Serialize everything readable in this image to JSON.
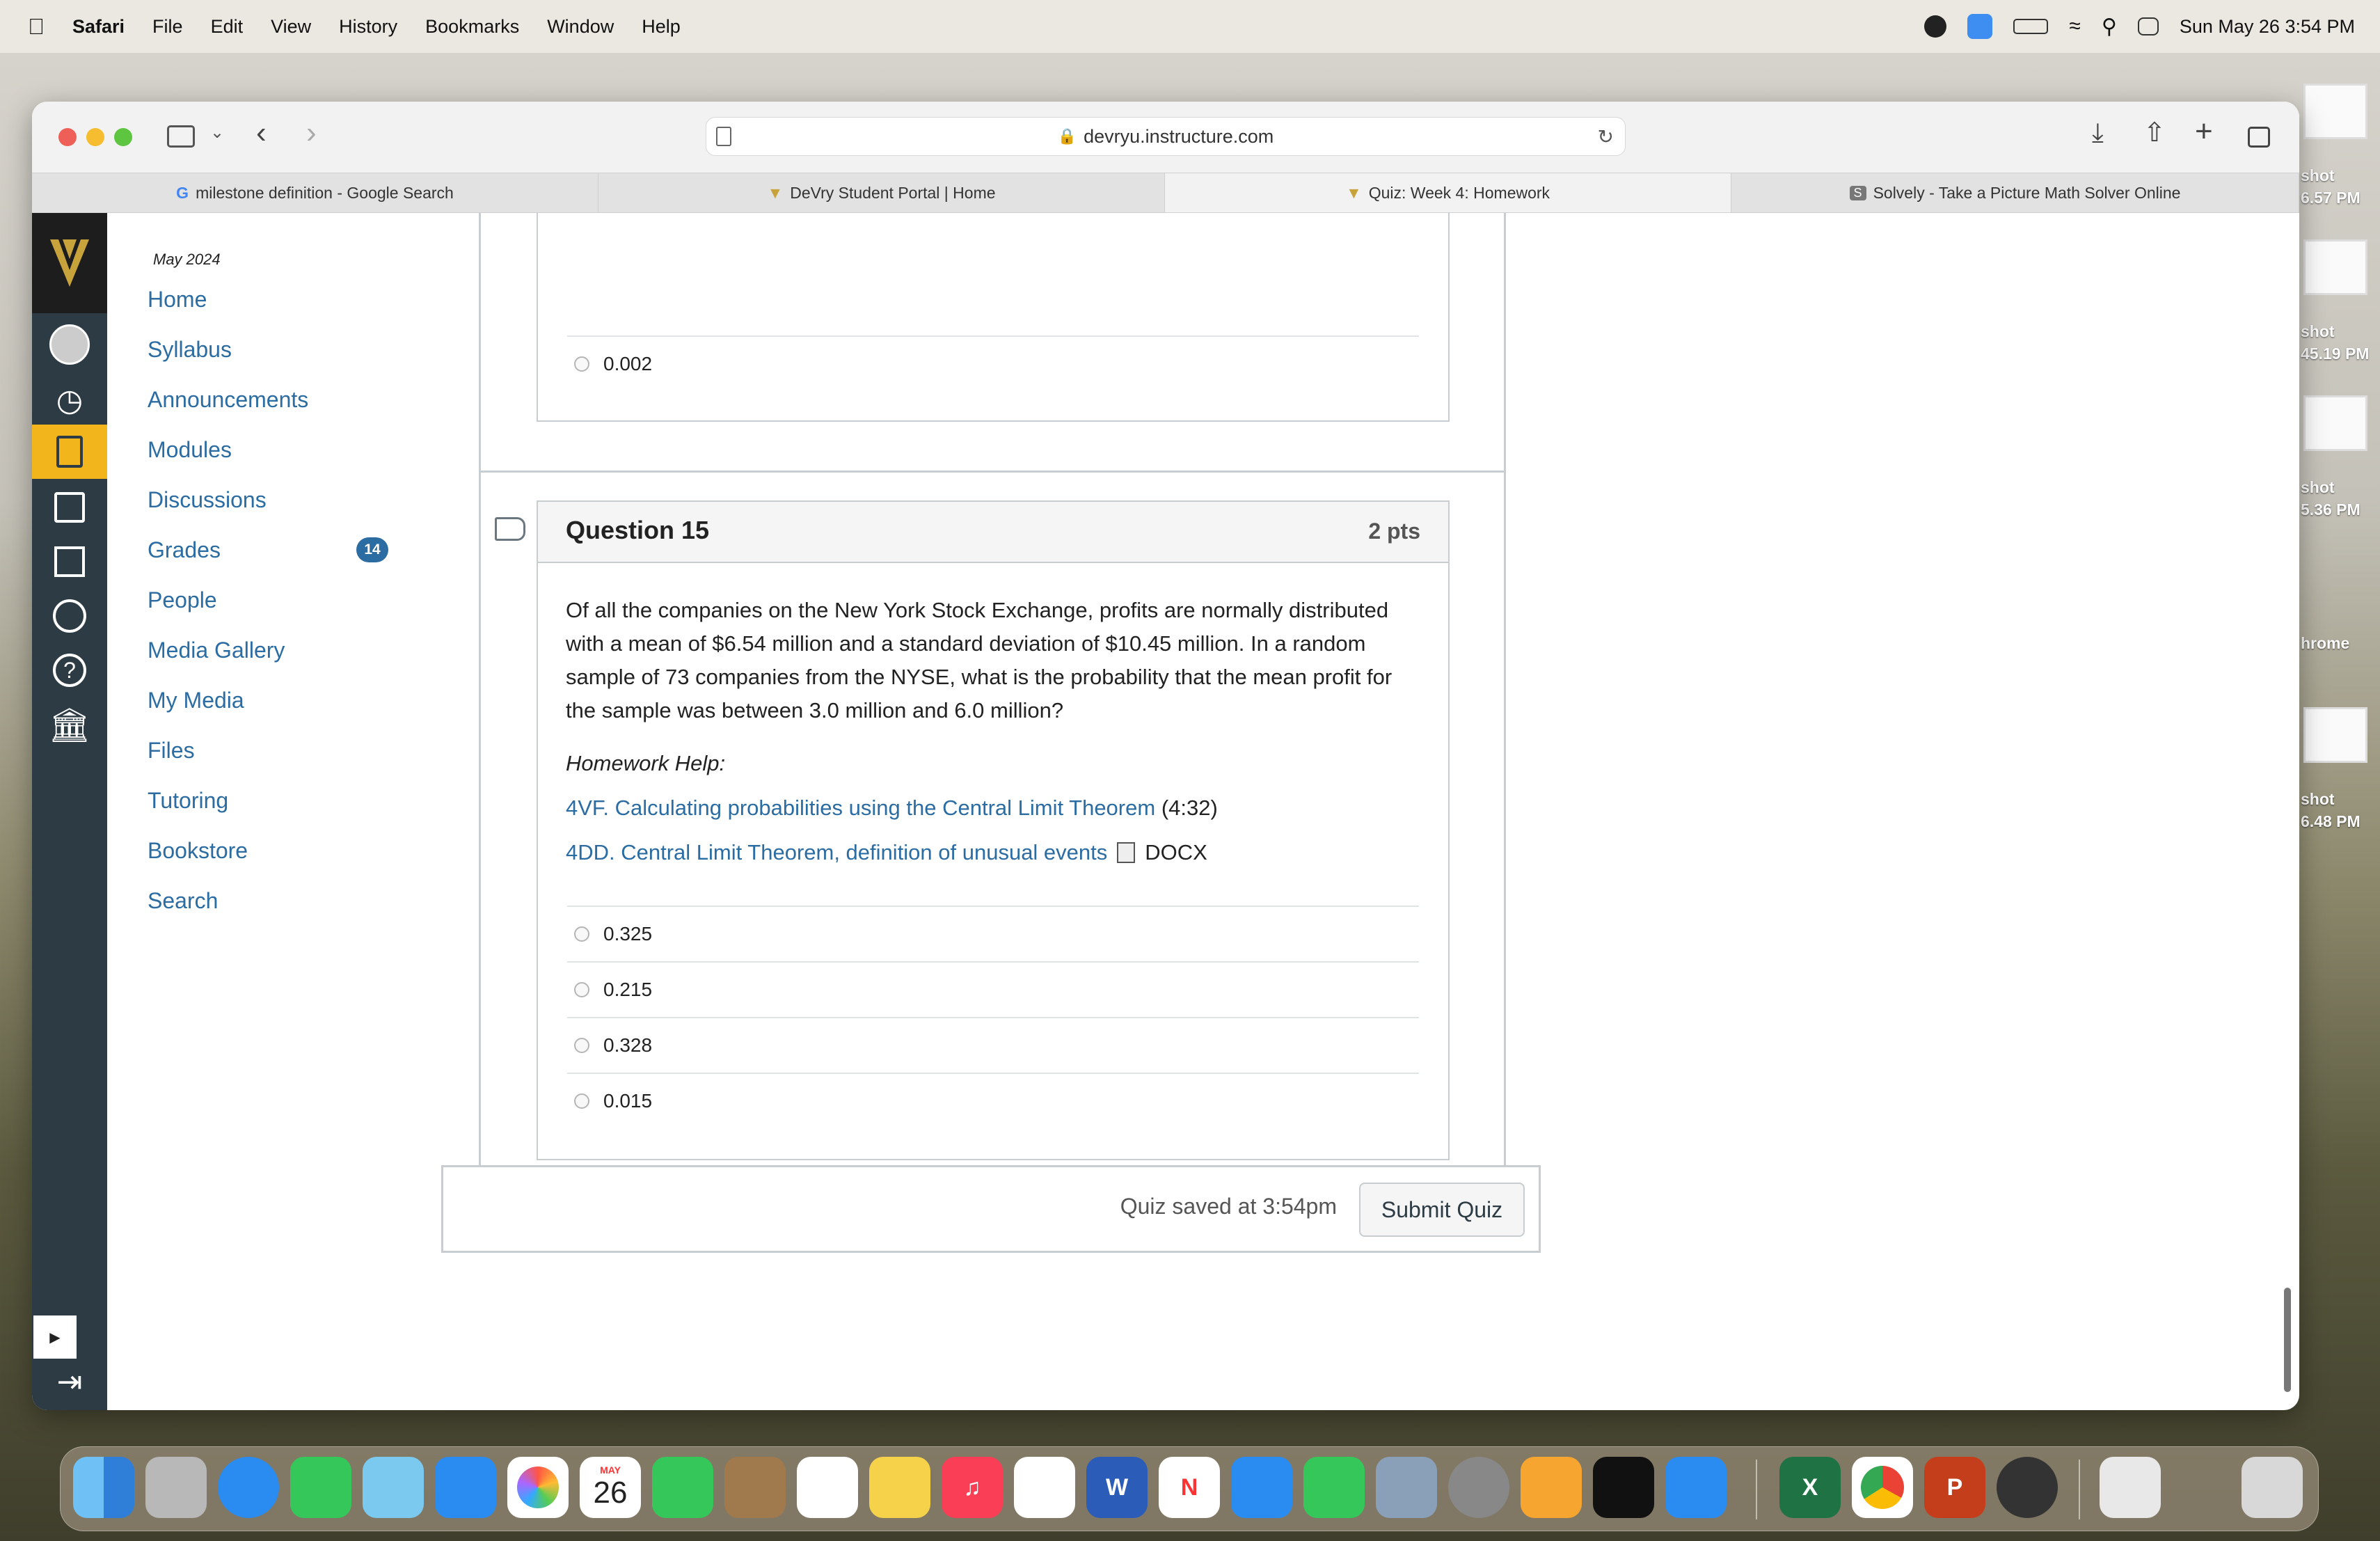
{
  "menubar": {
    "app": "Safari",
    "items": [
      "File",
      "Edit",
      "View",
      "History",
      "Bookmarks",
      "Window",
      "Help"
    ],
    "clock": "Sun May 26  3:54 PM"
  },
  "browser": {
    "url": "devryu.instructure.com",
    "tabs": [
      {
        "label": "milestone definition - Google Search"
      },
      {
        "label": "DeVry Student Portal | Home"
      },
      {
        "label": "Quiz: Week 4: Homework"
      },
      {
        "label": "Solvely - Take a Picture Math Solver Online"
      }
    ]
  },
  "course_nav": {
    "term": "May 2024",
    "links": [
      "Home",
      "Syllabus",
      "Announcements",
      "Modules",
      "Discussions",
      "Grades",
      "People",
      "Media Gallery",
      "My Media",
      "Files",
      "Tutoring",
      "Bookstore",
      "Search"
    ],
    "grades_badge": "14"
  },
  "prev_question": {
    "last_answer": "0.002"
  },
  "question": {
    "title": "Question 15",
    "points": "2 pts",
    "text": "Of all the companies on the New York Stock Exchange, profits are normally distributed with a mean of $6.54 million and a standard deviation of $10.45 million. In a random sample of 73 companies from the NYSE, what is the probability that the mean profit for the sample was between 3.0 million and 6.0 million?",
    "help_label": "Homework Help:",
    "link1_text": "4VF. Calculating probabilities using the Central Limit Theorem",
    "link1_suffix": "(4:32)",
    "link2_text": "4DD. Central Limit Theorem, definition of unusual events",
    "link2_suffix": "DOCX",
    "answers": [
      "0.325",
      "0.215",
      "0.328",
      "0.015"
    ]
  },
  "submit": {
    "saved_text": "Quiz saved at 3:54pm",
    "button_label": "Submit Quiz"
  },
  "desktop_labels": [
    [
      "shot",
      "6.57 PM"
    ],
    [
      "shot",
      "45.19 PM"
    ],
    [
      "shot",
      "5.36 PM"
    ],
    [
      "hrome",
      ""
    ],
    [
      "shot",
      "6.48 PM"
    ]
  ],
  "dock_calendar": {
    "month": "MAY",
    "day": "26"
  }
}
